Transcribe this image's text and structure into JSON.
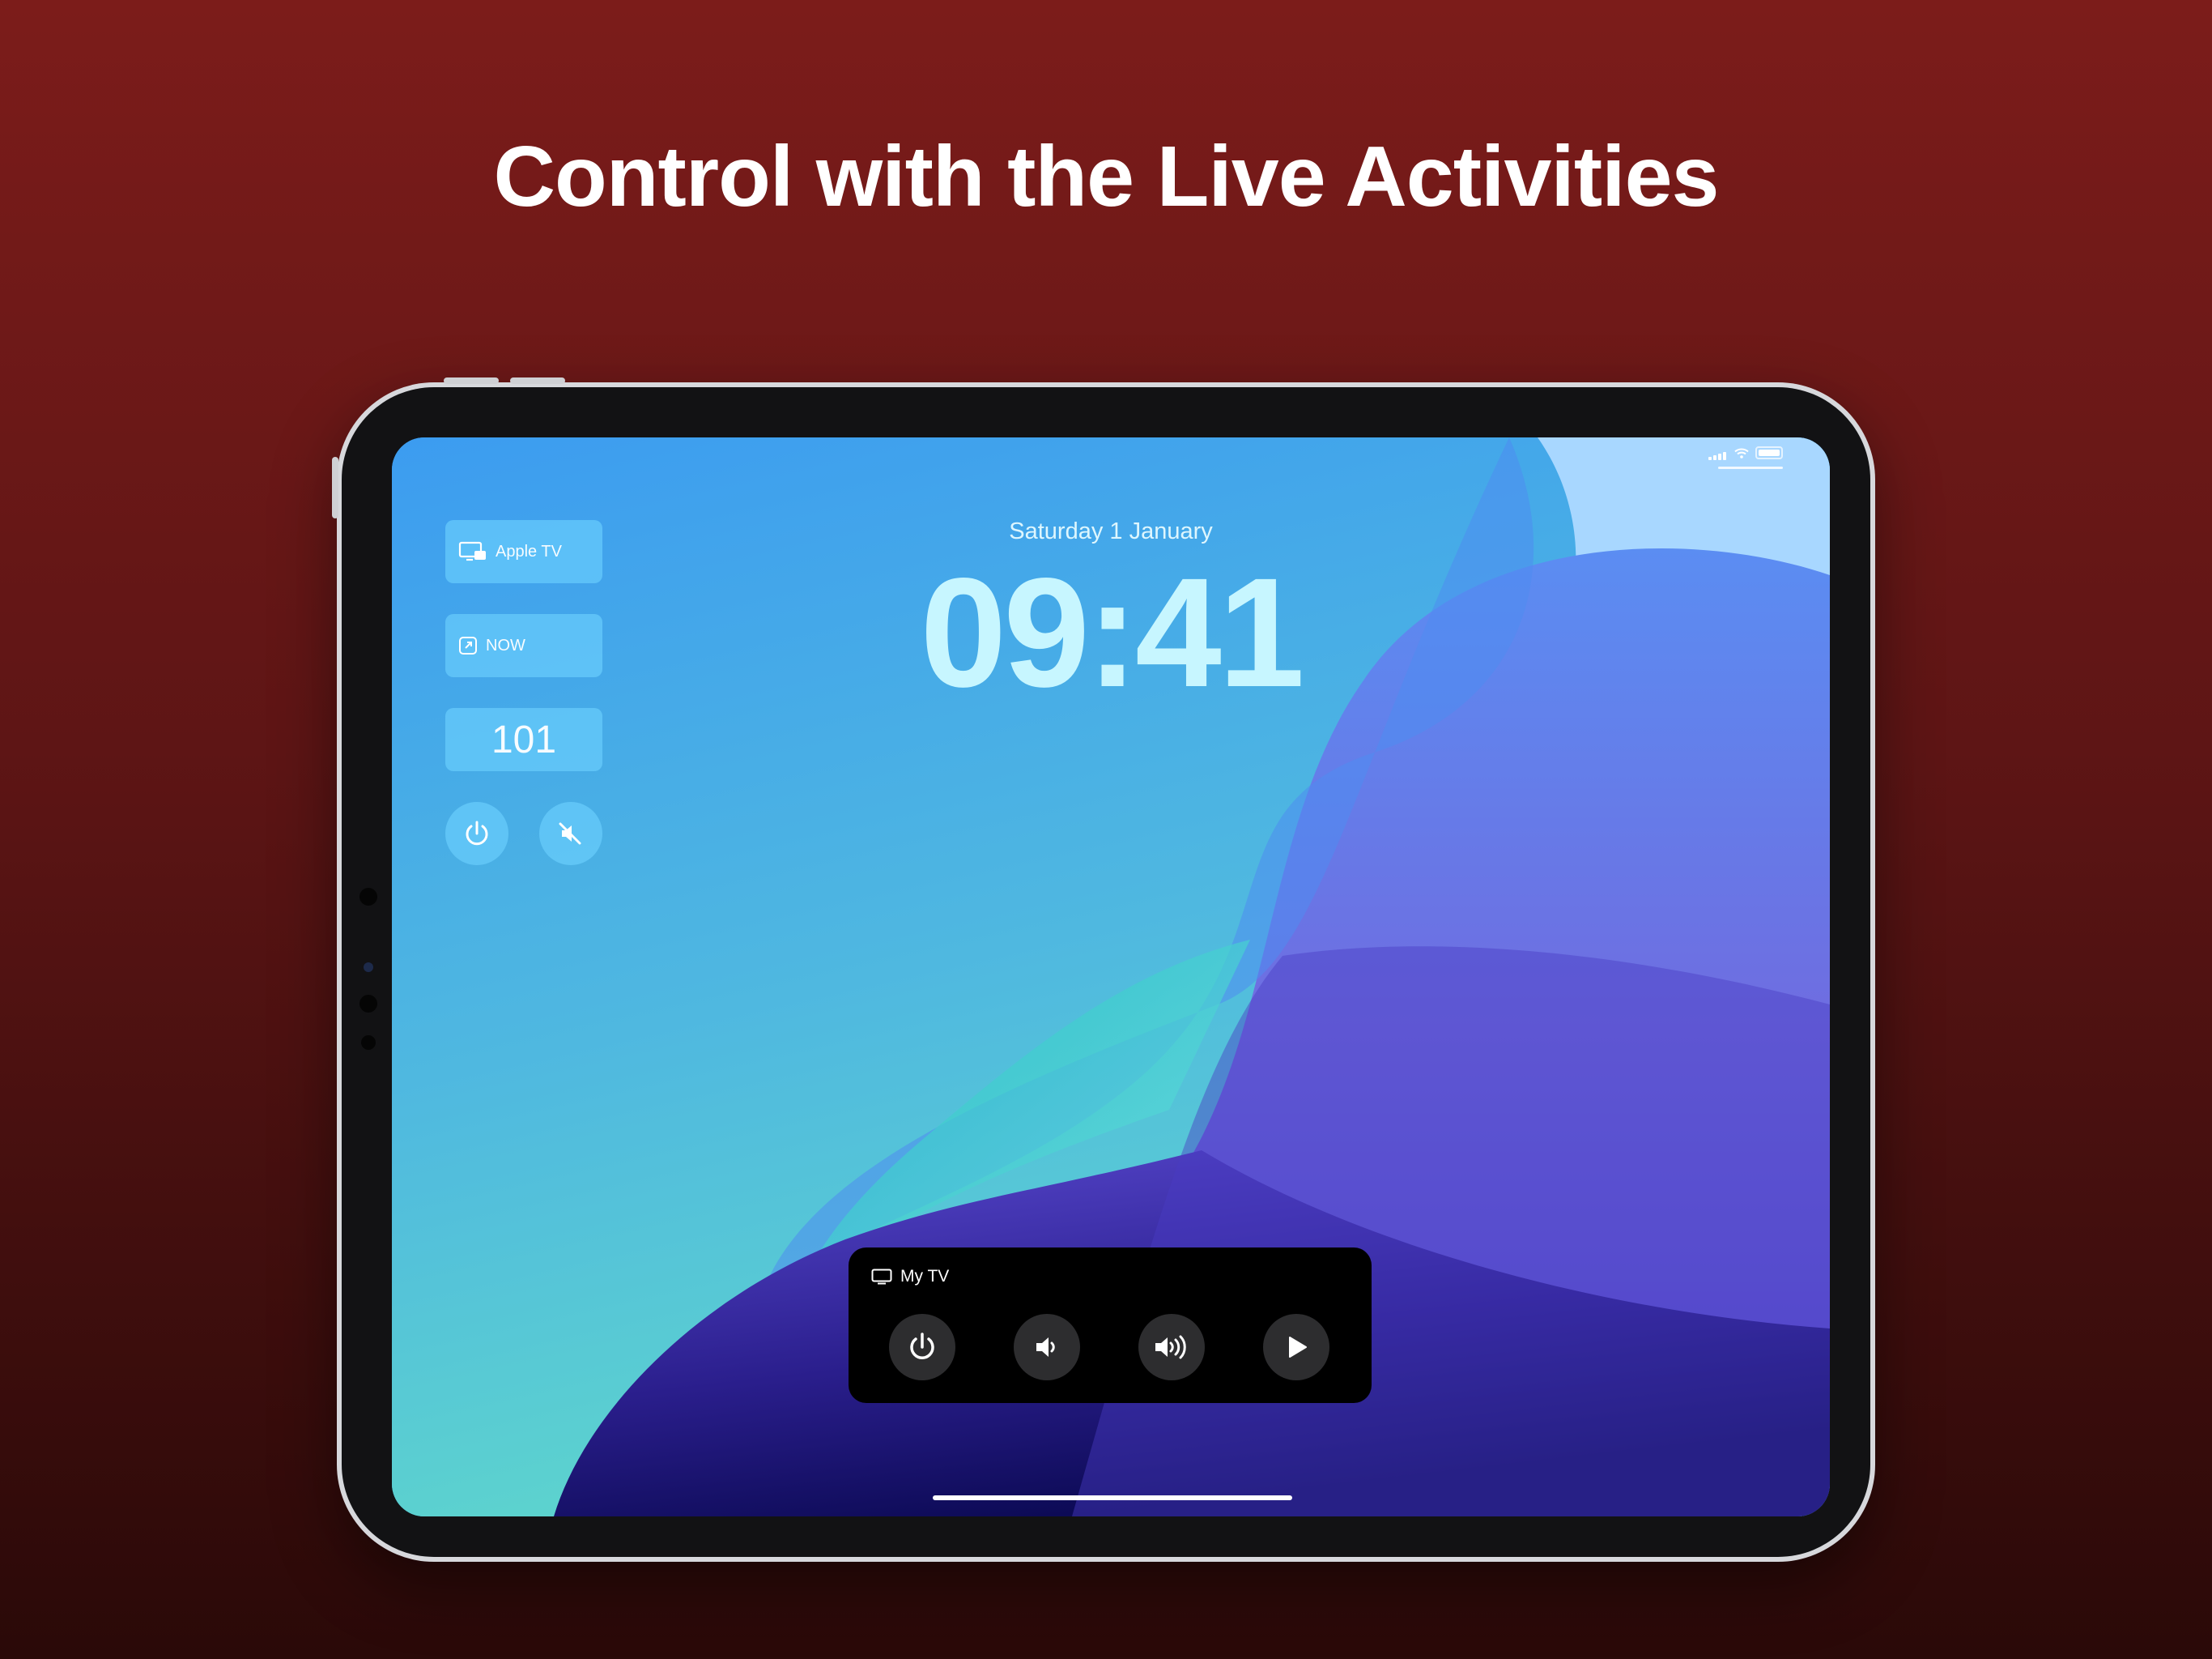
{
  "headline": "Control with the Live Activities",
  "lock_screen": {
    "date": "Saturday 1 January",
    "time": "09:41"
  },
  "widgets": {
    "apple_tv_label": "Apple TV",
    "now_label": "NOW",
    "channel_number": "101",
    "power_icon": "power-icon",
    "mute_icon": "speaker-mute-icon"
  },
  "live_activity": {
    "device_name": "My TV",
    "device_icon": "tv-icon",
    "controls": [
      {
        "icon": "power-icon"
      },
      {
        "icon": "volume-down-icon"
      },
      {
        "icon": "volume-up-icon"
      },
      {
        "icon": "play-icon"
      }
    ]
  },
  "colors": {
    "background_top": "#7c1c1a",
    "background_bottom": "#2a0908",
    "widget_fill": "#6ed2ff",
    "live_activity_bg": "#000000",
    "control_bg": "#2d2d2f"
  }
}
